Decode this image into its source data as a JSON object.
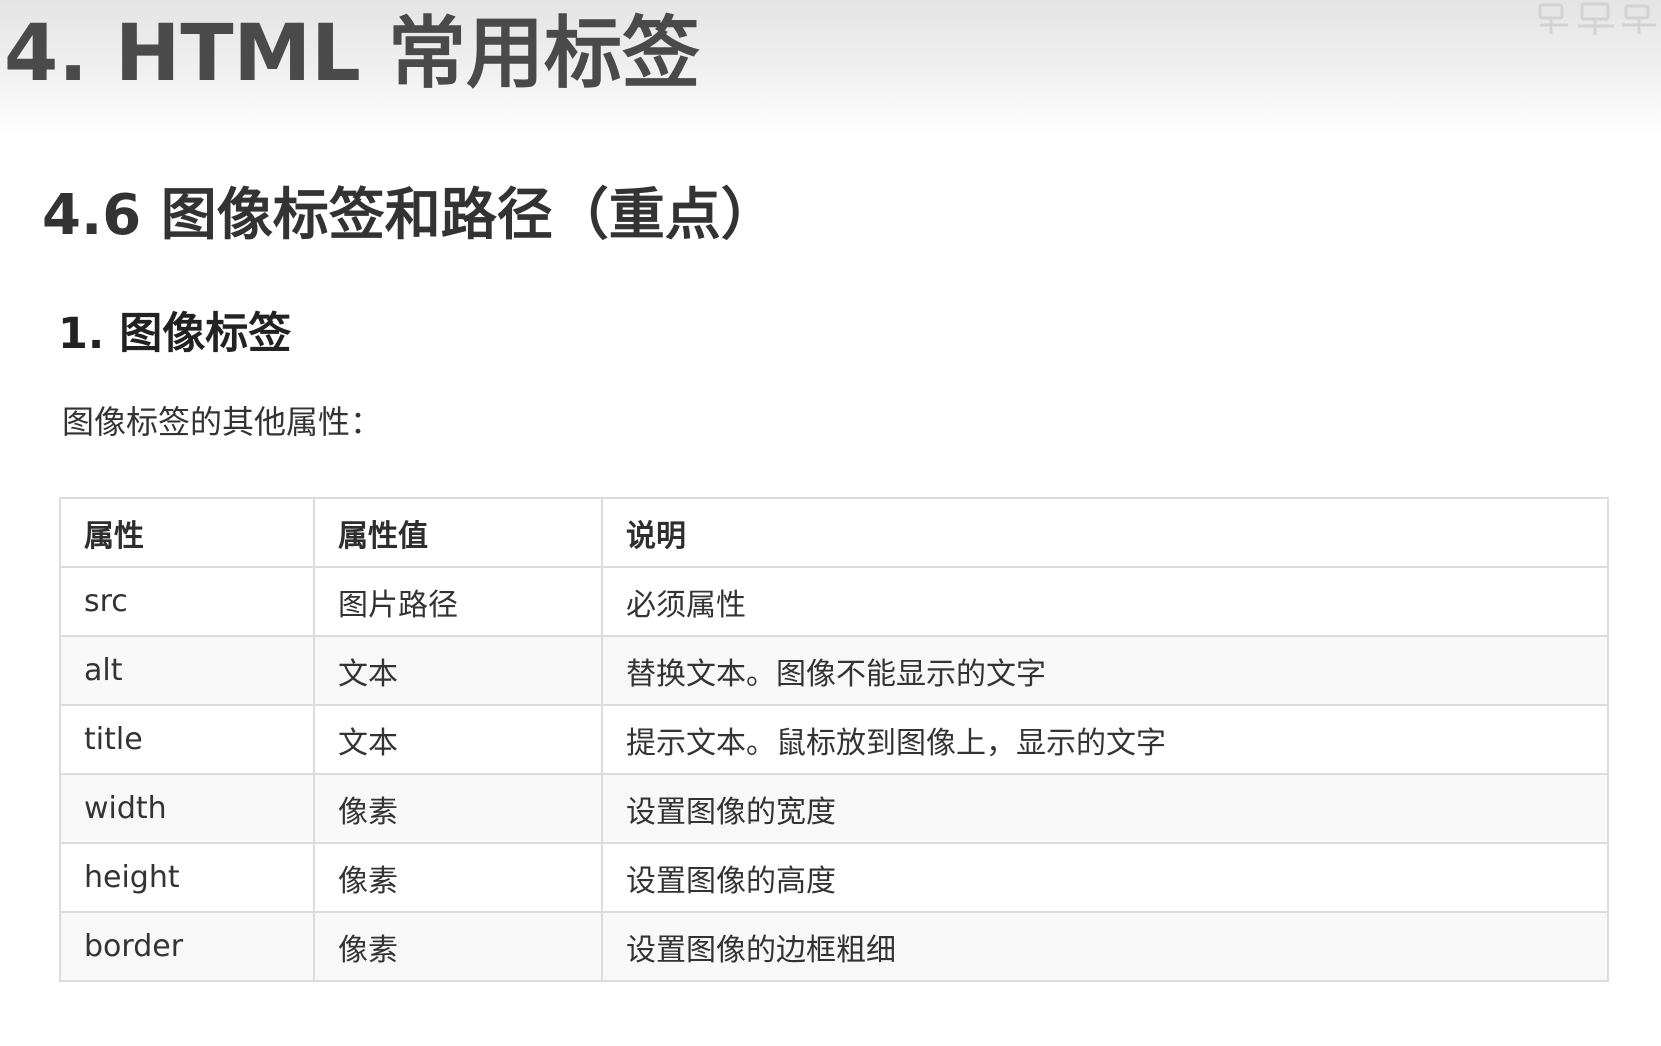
{
  "header": {
    "title": "4. HTML 常用标签"
  },
  "section": {
    "heading": "4.6 图像标签和路径（重点）",
    "subheading": "1. 图像标签",
    "intro": "图像标签的其他属性："
  },
  "table": {
    "headers": [
      "属性",
      "属性值",
      "说明"
    ],
    "rows": [
      [
        "src",
        "图片路径",
        "必须属性"
      ],
      [
        "alt",
        "文本",
        "替换文本。图像不能显示的文字"
      ],
      [
        "title",
        "文本",
        "提示文本。鼠标放到图像上，显示的文字"
      ],
      [
        "width",
        "像素",
        "设置图像的宽度"
      ],
      [
        "height",
        "像素",
        "设置图像的高度"
      ],
      [
        "border",
        "像素",
        "设置图像的边框粗细"
      ]
    ]
  },
  "colors": {
    "title_text": "#4a4a4a",
    "header_band": "#e4e4e4",
    "table_border": "#dcdcdc",
    "row_alt": "#f8f8f8"
  },
  "icons": {
    "corner": "watermark-logo-icon"
  }
}
